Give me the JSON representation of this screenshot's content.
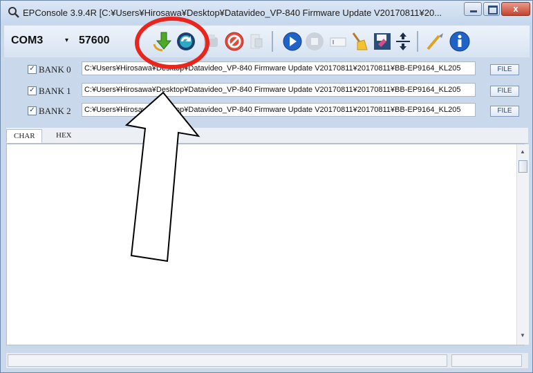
{
  "window": {
    "title": "EPConsole 3.9.4R  [C:¥Users¥Hirosawa¥Desktop¥Datavideo_VP-840 Firmware Update V20170811¥20...",
    "close_label": "x"
  },
  "toolbar": {
    "port_value": "COM3",
    "port_arrow": "▾",
    "baud_value": "57600",
    "icons": [
      "download-arrow-icon",
      "sync-icon",
      "disabled-tool-icon",
      "stop-icon",
      "disabled-hand-icon",
      "play-icon",
      "record-icon",
      "clear-icon",
      "broom-icon",
      "save-icon",
      "split-icon",
      "wand-icon",
      "info-icon"
    ]
  },
  "banks": [
    {
      "label": "BANK 0",
      "checked": "✓",
      "path": "C:¥Users¥Hirosawa¥Desktop¥Datavideo_VP-840 Firmware Update V20170811¥20170811¥BB-EP9164_KL205",
      "file_label": "FILE"
    },
    {
      "label": "BANK 1",
      "checked": "✓",
      "path": "C:¥Users¥Hirosawa¥Desktop¥Datavideo_VP-840 Firmware Update V20170811¥20170811¥BB-EP9164_KL205",
      "file_label": "FILE"
    },
    {
      "label": "BANK 2",
      "checked": "✓",
      "path": "C:¥Users¥Hirosawa¥Desktop¥Datavideo_VP-840 Firmware Update V20170811¥20170811¥BB-EP9164_KL205",
      "file_label": "FILE"
    }
  ],
  "tabs": [
    "CHAR",
    "HEX"
  ],
  "colors": {
    "annotation_circle": "#e8261e",
    "accent_blue": "#1f63c6"
  }
}
